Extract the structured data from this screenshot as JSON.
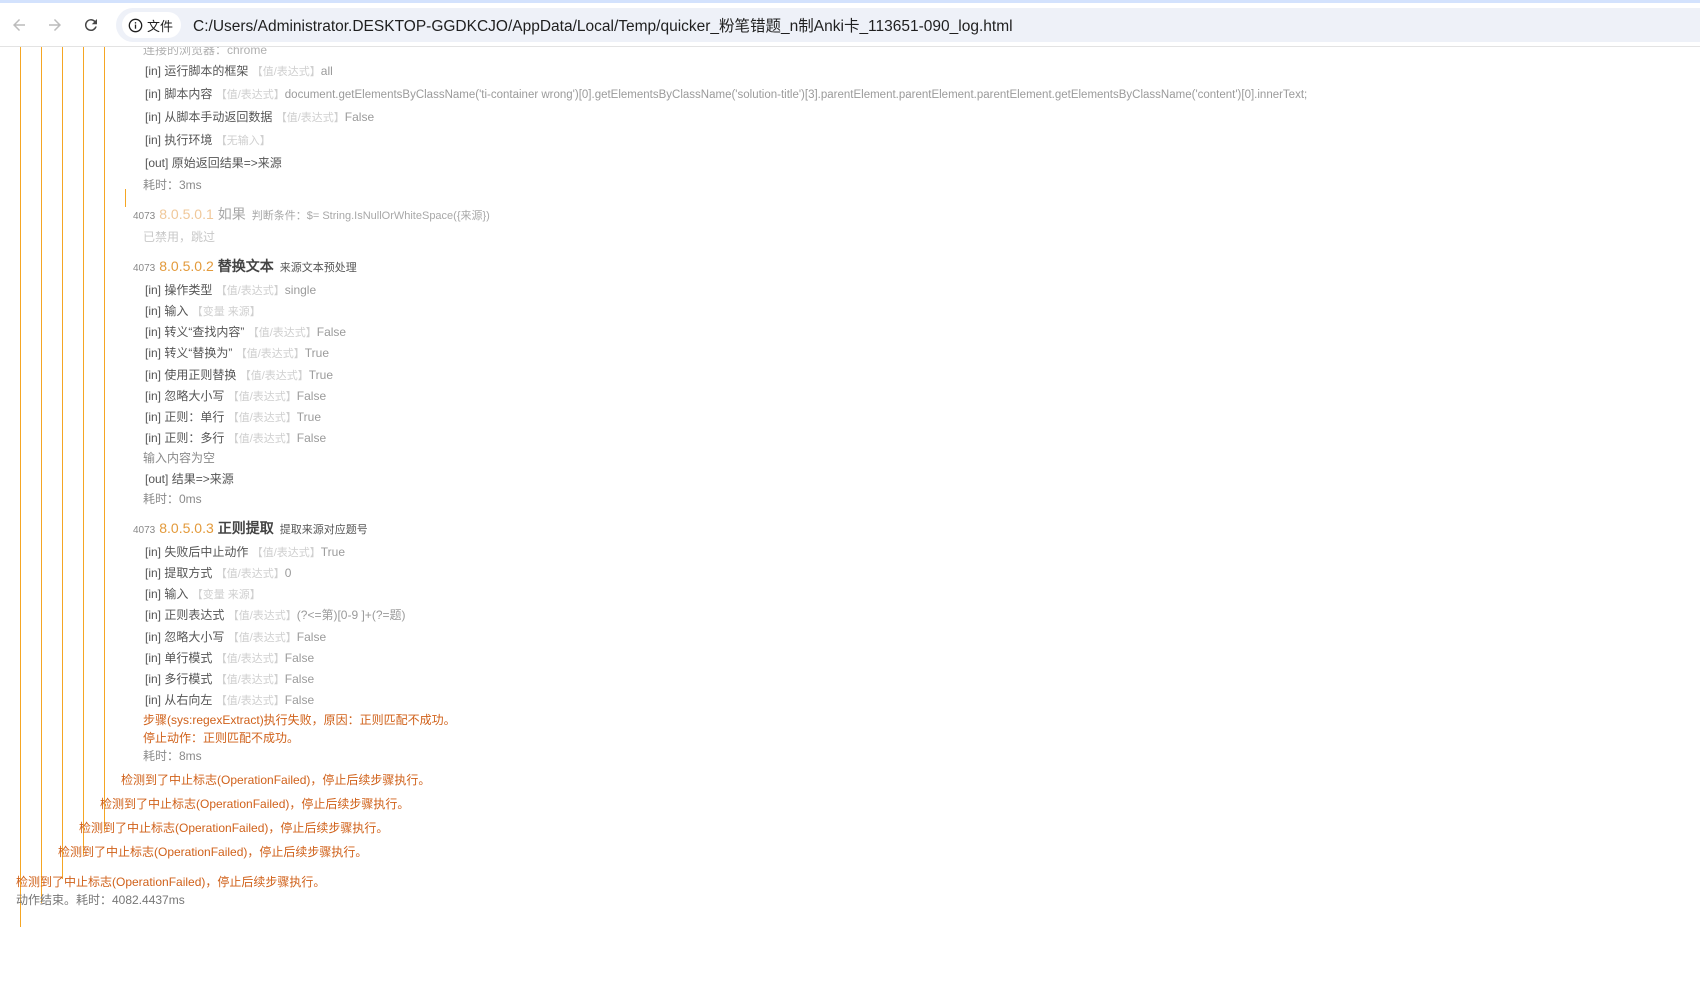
{
  "browser": {
    "security_chip_label": "文件",
    "url": "C:/Users/Administrator.DESKTOP-GGDKCJO/AppData/Local/Temp/quicker_粉笔错题_n制Anki卡_113651-090_log.html"
  },
  "log": {
    "connected_browser": "连接的浏览器：chrome",
    "block1": {
      "lines": [
        {
          "tag": "[in]",
          "name": "运行脚本的框架",
          "kind": "【值/表达式】",
          "value": "all"
        },
        {
          "tag": "[in]",
          "name": "脚本内容",
          "kind": "【值/表达式】",
          "value": "document.getElementsByClassName('ti-container wrong')[0].getElementsByClassName('solution-title')[3].parentElement.parentElement.parentElement.getElementsByClassName('content')[0].innerText;"
        },
        {
          "tag": "[in]",
          "name": "从脚本手动返回数据",
          "kind": "【值/表达式】",
          "value": "False"
        },
        {
          "tag": "[in]",
          "name": "执行环境",
          "kind": "【无输入】",
          "value": ""
        },
        {
          "tag": "[out]",
          "name": "原始返回结果=>来源",
          "kind": "",
          "value": ""
        }
      ],
      "time": "耗时：3ms"
    },
    "step_if": {
      "id": "4073",
      "num": "8.0.5.0.1",
      "name": "如果",
      "desc": "判断条件：$= String.IsNullOrWhiteSpace({来源})",
      "status": "已禁用，跳过"
    },
    "step_replace": {
      "id": "4073",
      "num": "8.0.5.0.2",
      "name": "替换文本",
      "desc": "来源文本预处理",
      "lines": [
        {
          "tag": "[in]",
          "name": "操作类型",
          "kind": "【值/表达式】",
          "value": "single"
        },
        {
          "tag": "[in]",
          "name": "输入",
          "kind": "【变量 来源】",
          "value": ""
        },
        {
          "tag": "[in]",
          "name": "转义“查找内容”",
          "kind": "【值/表达式】",
          "value": "False"
        },
        {
          "tag": "[in]",
          "name": "转义“替换为”",
          "kind": "【值/表达式】",
          "value": "True"
        },
        {
          "tag": "[in]",
          "name": "使用正则替换",
          "kind": "【值/表达式】",
          "value": "True"
        },
        {
          "tag": "[in]",
          "name": "忽略大小写",
          "kind": "【值/表达式】",
          "value": "False"
        },
        {
          "tag": "[in]",
          "name": "正则：单行",
          "kind": "【值/表达式】",
          "value": "True"
        },
        {
          "tag": "[in]",
          "name": "正则：多行",
          "kind": "【值/表达式】",
          "value": "False"
        }
      ],
      "note": "输入内容为空",
      "out": {
        "tag": "[out]",
        "name": "结果=>来源"
      },
      "time": "耗时：0ms"
    },
    "step_regex": {
      "id": "4073",
      "num": "8.0.5.0.3",
      "name": "正则提取",
      "desc": "提取来源对应题号",
      "lines": [
        {
          "tag": "[in]",
          "name": "失败后中止动作",
          "kind": "【值/表达式】",
          "value": "True"
        },
        {
          "tag": "[in]",
          "name": "提取方式",
          "kind": "【值/表达式】",
          "value": "0"
        },
        {
          "tag": "[in]",
          "name": "输入",
          "kind": "【变量 来源】",
          "value": ""
        },
        {
          "tag": "[in]",
          "name": "正则表达式",
          "kind": "【值/表达式】",
          "value": "(?<=第)[0-9 ]+(?=题)"
        },
        {
          "tag": "[in]",
          "name": "忽略大小写",
          "kind": "【值/表达式】",
          "value": "False"
        },
        {
          "tag": "[in]",
          "name": "单行模式",
          "kind": "【值/表达式】",
          "value": "False"
        },
        {
          "tag": "[in]",
          "name": "多行模式",
          "kind": "【值/表达式】",
          "value": "False"
        },
        {
          "tag": "[in]",
          "name": "从右向左",
          "kind": "【值/表达式】",
          "value": "False"
        }
      ],
      "error1": "步骤(sys:regexExtract)执行失败，原因：正则匹配不成功。",
      "error2": "停止动作：正则匹配不成功。",
      "time": "耗时：8ms"
    },
    "abort_message": "检测到了中止标志(OperationFailed)，停止后续步骤执行。",
    "final_result": "动作结束。耗时：4082.4437ms"
  },
  "colors": {
    "accent_orange": "#f5a623",
    "step_number": "#e39a3b",
    "error_text": "#d0611a"
  }
}
